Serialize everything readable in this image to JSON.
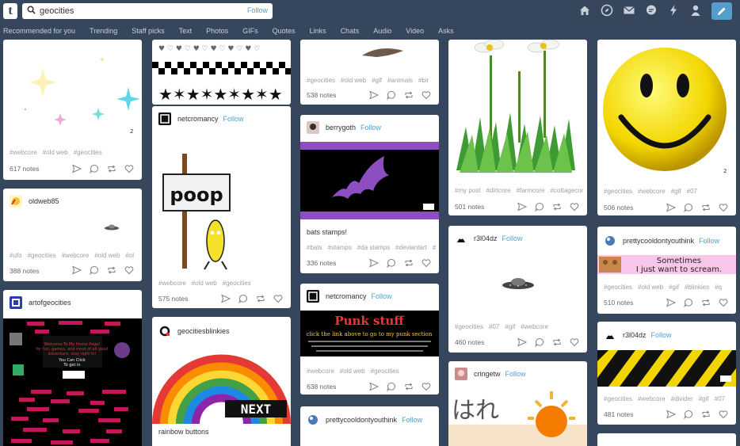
{
  "header": {
    "logo": "t",
    "search_value": "geocities",
    "follow_label": "Follow"
  },
  "tabs": [
    "Recommended for you",
    "Trending",
    "Staff picks",
    "Text",
    "Photos",
    "GIFs",
    "Quotes",
    "Links",
    "Chats",
    "Audio",
    "Video",
    "Asks"
  ],
  "posts": {
    "p1": {
      "tags": [
        "#webcore",
        "#old web",
        "#geocities"
      ],
      "notes": "617 notes"
    },
    "p2": {
      "user": "oldweb85",
      "tags": [
        "#ufo",
        "#geocities",
        "#webcore",
        "#old web",
        "#ol"
      ],
      "notes": "388 notes"
    },
    "p3": {
      "user": "artofgeocities",
      "page_text": "Welcome To My Home Page! ... You Can Click To get in"
    },
    "p4": {
      "user": "netcromancy",
      "follow": "Follow",
      "sign_text": "poop",
      "tags": [
        "#webcore",
        "#old web",
        "#geocities"
      ],
      "notes": "575 notes"
    },
    "p5": {
      "user": "geocitiesblinkies",
      "blinkie_text": "NEXT",
      "caption": "rainbow buttons"
    },
    "p6": {
      "tags": [
        "#geocities",
        "#old web",
        "#gif",
        "#animals",
        "#bir"
      ],
      "notes": "538 notes"
    },
    "p7": {
      "user": "berrygoth",
      "follow": "Follow",
      "caption": "bats stamps!",
      "tags": [
        "#bats",
        "#stamps",
        "#da stamps",
        "#deviantart",
        "#"
      ],
      "notes": "336 notes"
    },
    "p8": {
      "user": "netcromancy",
      "follow": "Follow",
      "banner_title": "Punk stuff",
      "banner_sub": "click the link above to go to my punk section",
      "tags": [
        "#webcore",
        "#old web",
        "#geocities"
      ],
      "notes": "638 notes"
    },
    "p9": {
      "user": "prettycooldontyouthink",
      "follow": "Follow"
    },
    "p10": {
      "tags": [
        "#my post",
        "#dirtcore",
        "#farmcore",
        "#cottagecor"
      ],
      "notes": "501 notes"
    },
    "p11": {
      "user": "r3l04dz",
      "follow": "Follow",
      "tags": [
        "#geocities",
        "#07",
        "#gif",
        "#webcore"
      ],
      "notes": "460 notes"
    },
    "p12": {
      "user": "cringetw",
      "follow": "Follow",
      "image_text": "はれ"
    },
    "p13": {
      "tags": [
        "#geocities",
        "#webcore",
        "#gif",
        "#07"
      ],
      "notes": "506 notes"
    },
    "p14": {
      "user": "prettycooldontyouthink",
      "follow": "Follow",
      "blinkie_line1": "Sometimes",
      "blinkie_line2": "I just want to scream.",
      "tags": [
        "#geocities",
        "#old web",
        "#gif",
        "#blinkies",
        "#q"
      ],
      "notes": "510 notes"
    },
    "p15": {
      "user": "r3l04dz",
      "follow": "Follow",
      "tags": [
        "#geocities",
        "#webcore",
        "#divider",
        "#gif",
        "#07"
      ],
      "notes": "481 notes"
    }
  },
  "colors": {
    "bg": "#36465d",
    "accent": "#529ecc"
  }
}
